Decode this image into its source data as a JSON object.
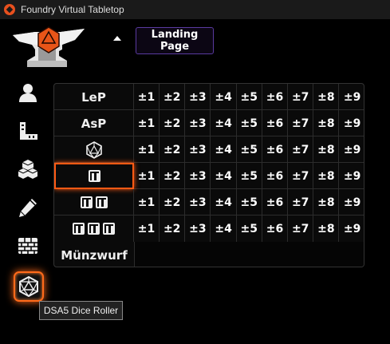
{
  "window": {
    "title": "Foundry Virtual Tabletop",
    "app_icon": "foundry-d20-icon"
  },
  "header": {
    "landing_label": "Landing Page",
    "collapse_icon": "caret-up-icon"
  },
  "sidebar": {
    "tools": [
      {
        "name": "user-icon"
      },
      {
        "name": "ruler-icon"
      },
      {
        "name": "cubes-icon"
      },
      {
        "name": "pencil-icon"
      },
      {
        "name": "brick-wall-icon"
      },
      {
        "name": "d20-icon",
        "active": true
      }
    ],
    "tooltip": "DSA5 Dice Roller"
  },
  "roller": {
    "modifiers": [
      "±1",
      "±2",
      "±3",
      "±4",
      "±5",
      "±6",
      "±7",
      "±8",
      "±9"
    ],
    "rows": [
      {
        "label": "LeP",
        "type": "text"
      },
      {
        "label": "AsP",
        "type": "text"
      },
      {
        "label": "d20",
        "type": "d20"
      },
      {
        "label": "1d6",
        "type": "dice",
        "count": 1,
        "selected": true
      },
      {
        "label": "2d6",
        "type": "dice",
        "count": 2
      },
      {
        "label": "3d6",
        "type": "dice",
        "count": 3
      }
    ],
    "coin_label": "Münzwurf"
  },
  "colors": {
    "accent": "#ff6a1a",
    "landing_border": "#5a3aa0"
  }
}
